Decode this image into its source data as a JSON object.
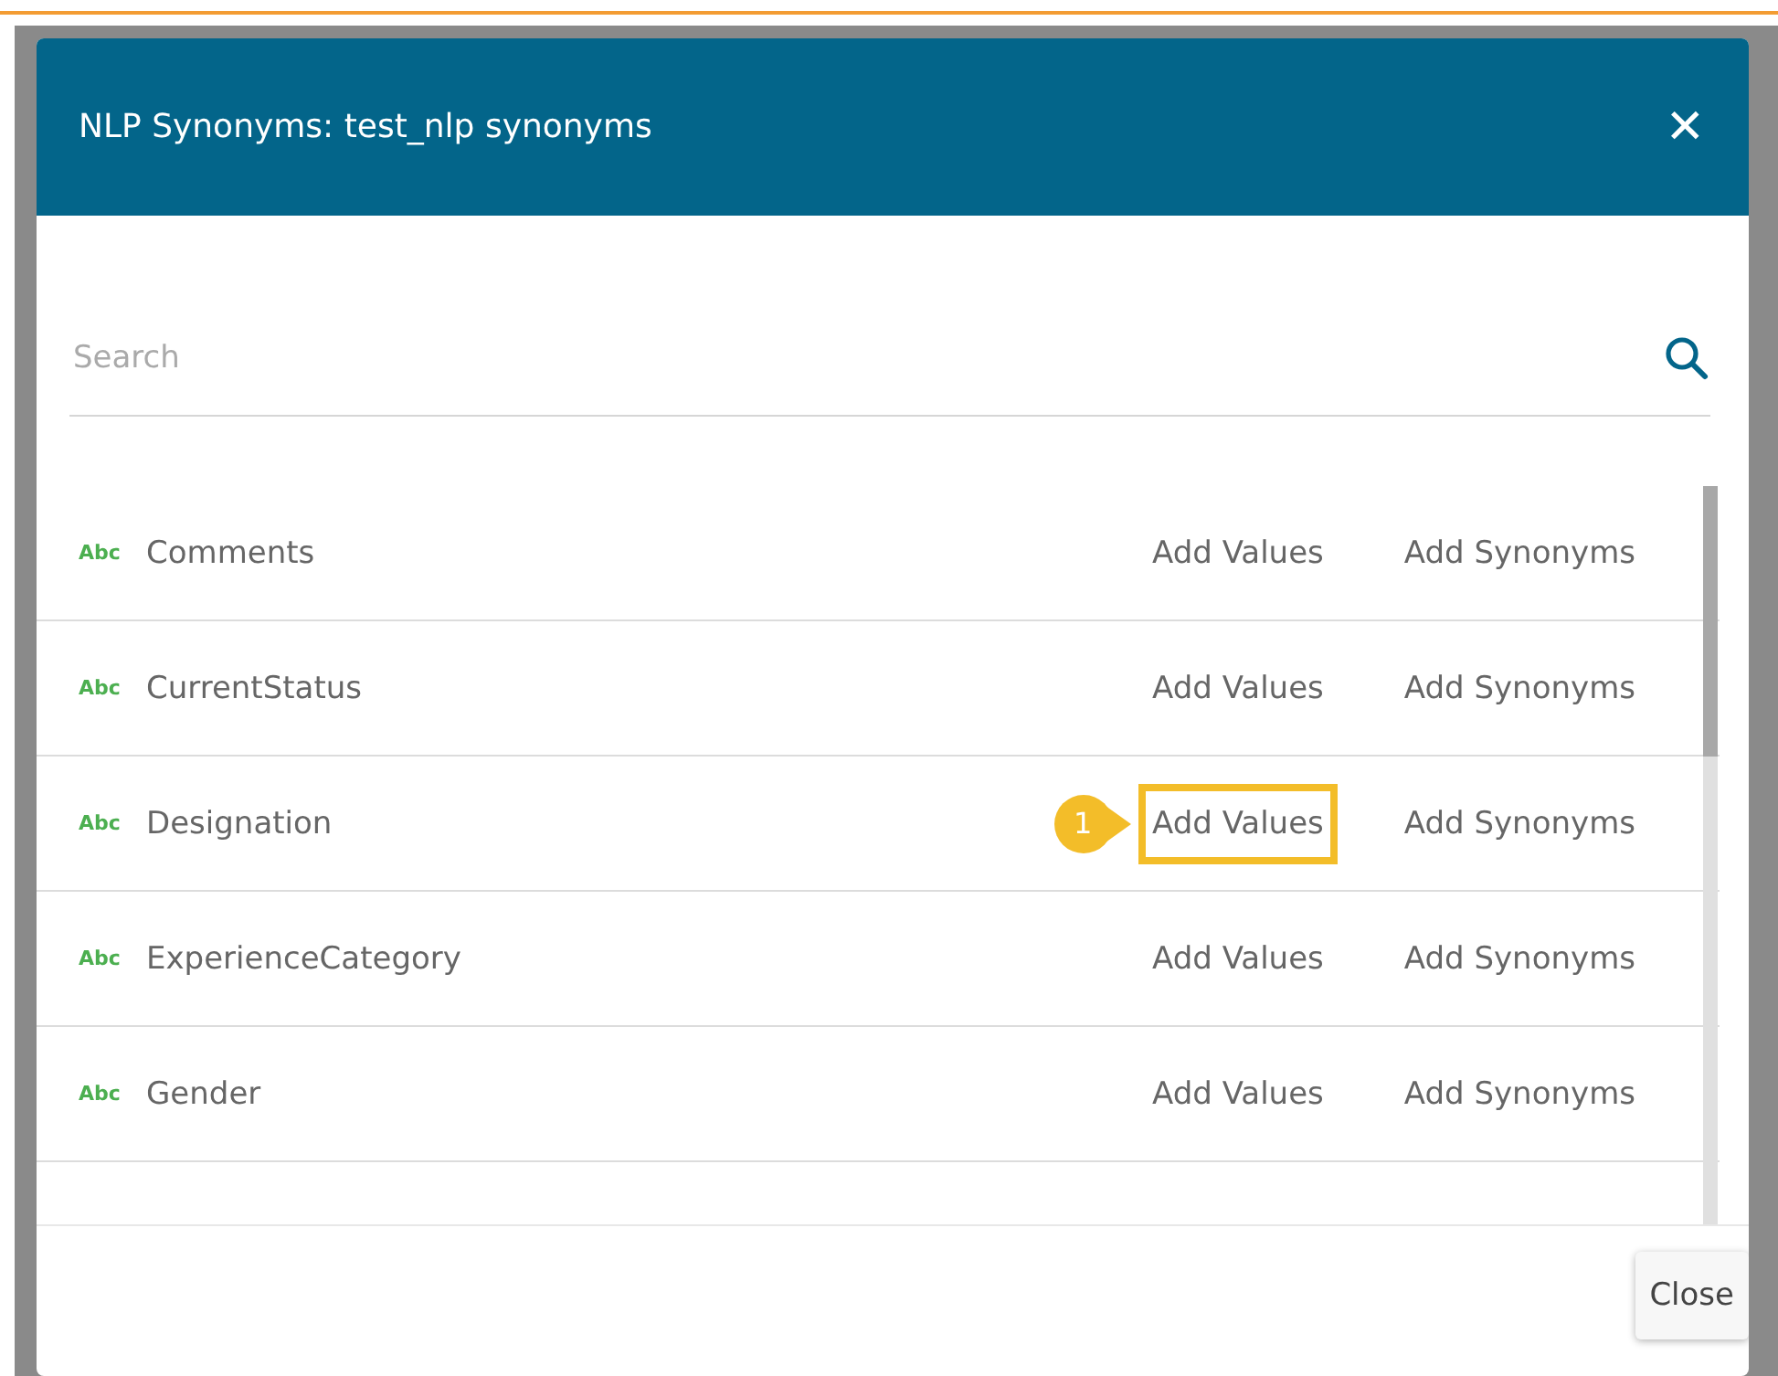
{
  "dialog": {
    "title": "NLP Synonyms: test_nlp synonyms",
    "close_icon": "✕"
  },
  "search": {
    "placeholder": "Search"
  },
  "rows": [
    {
      "type_label": "Abc",
      "name": "Comments",
      "values_action": "Add Values",
      "synonyms_action": "Add Synonyms",
      "highlighted": false
    },
    {
      "type_label": "Abc",
      "name": "CurrentStatus",
      "values_action": "Add Values",
      "synonyms_action": "Add Synonyms",
      "highlighted": false
    },
    {
      "type_label": "Abc",
      "name": "Designation",
      "values_action": "Add Values",
      "synonyms_action": "Add Synonyms",
      "highlighted": true,
      "callout": "1"
    },
    {
      "type_label": "Abc",
      "name": "ExperienceCategory",
      "values_action": "Add Values",
      "synonyms_action": "Add Synonyms",
      "highlighted": false
    },
    {
      "type_label": "Abc",
      "name": "Gender",
      "values_action": "Add Values",
      "synonyms_action": "Add Synonyms",
      "highlighted": false
    }
  ],
  "footer": {
    "close_button": "Close"
  }
}
